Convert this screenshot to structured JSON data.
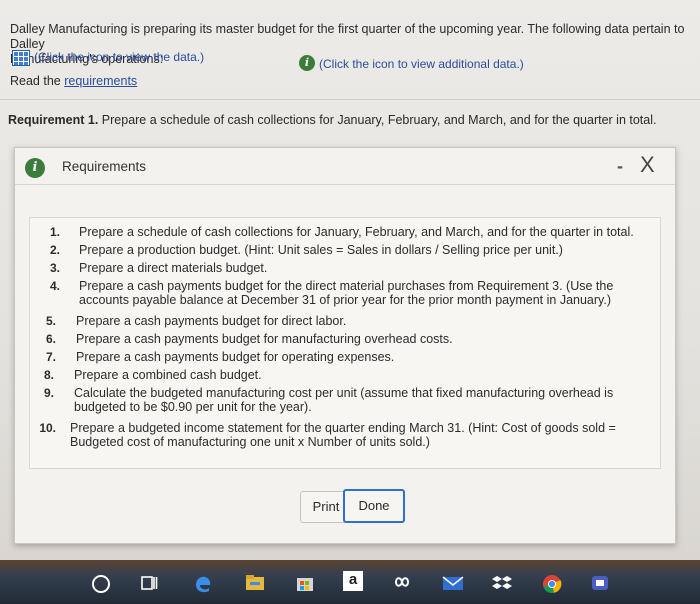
{
  "intro": {
    "line1": "Dalley Manufacturing is preparing its master budget for the first quarter of the upcoming year. The following data pertain to Dalley",
    "line2": "Manufacturing's operations:",
    "data_link": "(Click the icon to view the data.)",
    "additional_link": "(Click the icon to view additional data.)",
    "read_prefix": "Read the ",
    "read_link": "requirements"
  },
  "requirement1": {
    "label": "Requirement 1.",
    "text": " Prepare a schedule of cash collections for January, February, and March, and for the quarter in total."
  },
  "modal": {
    "title": "Requirements",
    "minimize": "-",
    "close": "X",
    "items": [
      {
        "num": "1.",
        "lines": [
          "Prepare a schedule of cash collections for January, February, and March, and for the quarter in total."
        ]
      },
      {
        "num": "2.",
        "lines": [
          "Prepare a production budget. (Hint: Unit sales = Sales in dollars / Selling price per unit.)"
        ]
      },
      {
        "num": "3.",
        "lines": [
          "Prepare a direct materials budget."
        ]
      },
      {
        "num": "4.",
        "lines": [
          "Prepare a cash payments budget for the direct material purchases from Requirement 3. (Use the",
          "accounts payable balance at December 31 of prior year for the prior month payment in January.)"
        ]
      },
      {
        "num": "5.",
        "lines": [
          "Prepare a cash payments budget for direct labor."
        ]
      },
      {
        "num": "6.",
        "lines": [
          "Prepare a cash payments budget for manufacturing overhead costs."
        ]
      },
      {
        "num": "7.",
        "lines": [
          "Prepare a cash payments budget for operating expenses."
        ]
      },
      {
        "num": "8.",
        "lines": [
          "Prepare a combined cash budget."
        ]
      },
      {
        "num": "9.",
        "lines": [
          "Calculate the budgeted manufacturing cost per unit (assume that fixed manufacturing overhead is",
          "budgeted to be $0.90 per unit for the year)."
        ]
      },
      {
        "num": "10.",
        "lines": [
          "Prepare a budgeted income statement for the quarter ending March 31. (Hint: Cost of goods sold =",
          "Budgeted cost of manufacturing one unit x Number of units sold.)"
        ]
      }
    ],
    "print_label": "Print",
    "done_label": "Done"
  },
  "taskbar": {
    "icons": [
      "cortana-icon",
      "task-view-icon",
      "edge-icon",
      "file-explorer-icon",
      "store-icon",
      "amazon-icon",
      "infinity-app-icon",
      "mail-icon",
      "dropbox-icon",
      "chrome-icon",
      "teams-icon"
    ],
    "amazon_glyph": "a"
  }
}
